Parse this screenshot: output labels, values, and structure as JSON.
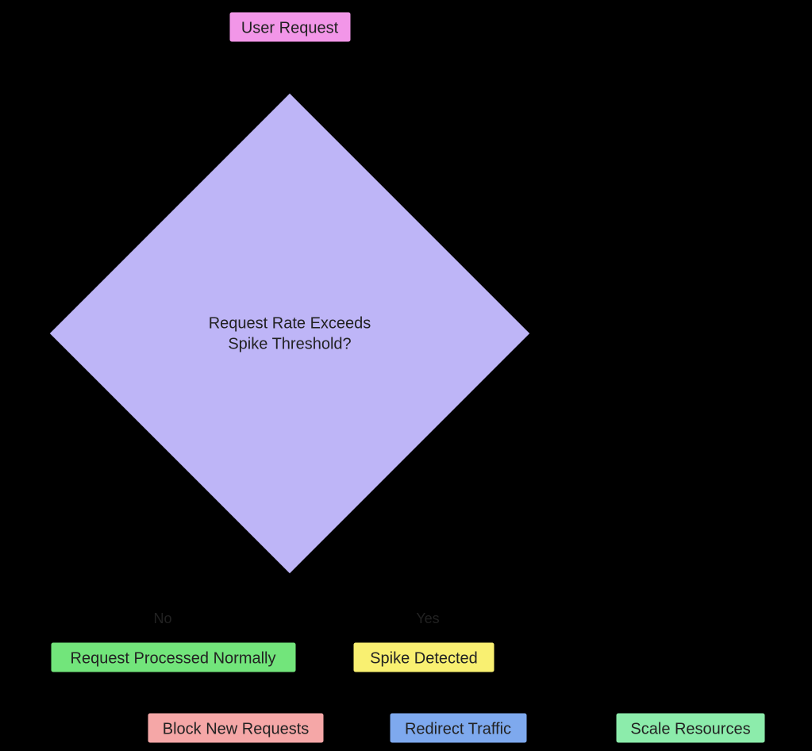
{
  "diagram": {
    "nodes": {
      "user_request": {
        "label": "User Request",
        "fill": "#f296e8"
      },
      "decision": {
        "line1": "Request Rate Exceeds",
        "line2": "Spike Threshold?",
        "fill": "#beb5f7"
      },
      "processed": {
        "label": "Request Processed Normally",
        "fill": "#72e57b"
      },
      "spike": {
        "label": "Spike Detected",
        "fill": "#f9f071"
      },
      "block": {
        "label": "Block New Requests",
        "fill": "#f5a7a7"
      },
      "redirect": {
        "label": "Redirect Traffic",
        "fill": "#7ea9ee"
      },
      "scale": {
        "label": "Scale Resources",
        "fill": "#8cecab"
      }
    },
    "edges": {
      "no_label": "No",
      "yes_label": "Yes"
    }
  }
}
